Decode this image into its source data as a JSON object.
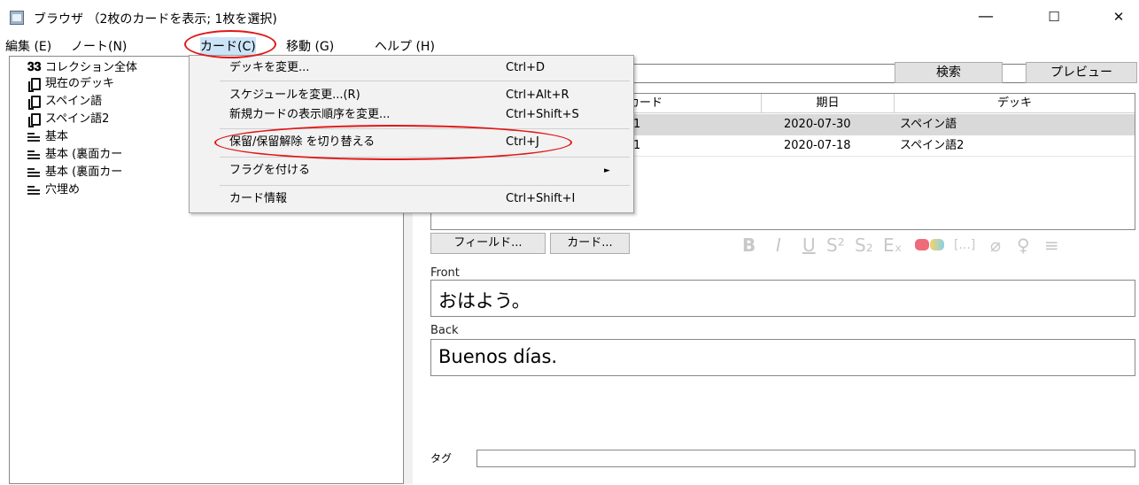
{
  "window": {
    "title": "ブラウザ （2枚のカードを表示; 1枚を選択)",
    "controls": {
      "minimize": "—",
      "maximize": "☐",
      "close": "✕"
    }
  },
  "menubar": [
    "編集 (E)",
    "ノート(N)",
    "カード(C)",
    "移動 (G)",
    "ヘルプ (H)"
  ],
  "sidebar": {
    "items": [
      {
        "label": "コレクション全体",
        "icon": "collection-icon"
      },
      {
        "label": "現在のデッキ",
        "icon": "deck-icon"
      },
      {
        "label": "スペイン語",
        "icon": "deck-icon"
      },
      {
        "label": "スペイン語2",
        "icon": "deck-icon"
      },
      {
        "label": "基本",
        "icon": "note-type-icon"
      },
      {
        "label": "基本 (裏面カー",
        "icon": "note-type-icon"
      },
      {
        "label": "基本 (裏面カー",
        "icon": "note-type-icon"
      },
      {
        "label": "穴埋め",
        "icon": "note-type-icon"
      }
    ]
  },
  "search": {
    "dropdown_chevron": "﹀",
    "search_button": "検索",
    "preview_button": "プレビュー"
  },
  "table": {
    "columns": [
      "カード",
      "期日",
      "デッキ"
    ],
    "rows": [
      {
        "card": "1",
        "due": "2020-07-30",
        "deck": "スペイン語",
        "selected": true
      },
      {
        "card": "1",
        "due": "2020-07-18",
        "deck": "スペイン語2",
        "selected": false
      }
    ]
  },
  "editor": {
    "fields_button": "フィールド...",
    "cards_button": "カード...",
    "format_buttons": [
      "B",
      "I",
      "U",
      "S²",
      "S₂",
      "Eₓ",
      "[...]",
      "⌀",
      "♀",
      "≡"
    ],
    "colors": {
      "text_color": "#ee6b7a",
      "highlight_left": "#f5d36a",
      "highlight_right": "#8ad0e8"
    },
    "front_label": "Front",
    "front_value": "おはよう。",
    "back_label": "Back",
    "back_value": "Buenos días.",
    "tags_label": "タグ",
    "tags_value": ""
  },
  "card_menu": {
    "items": [
      {
        "label": "デッキを変更...",
        "shortcut": "Ctrl+D"
      },
      {
        "label": "スケジュールを変更...(R)",
        "shortcut": "Ctrl+Alt+R"
      },
      {
        "label": "新規カードの表示順序を変更...",
        "shortcut": "Ctrl+Shift+S"
      },
      {
        "label": "保留/保留解除 を切り替える",
        "shortcut": "Ctrl+J"
      },
      {
        "label": "フラグを付ける",
        "shortcut": ""
      },
      {
        "label": "カード情報",
        "shortcut": "Ctrl+Shift+I"
      }
    ],
    "submenu_arrow": "►"
  },
  "annotation_color": "#e01818"
}
